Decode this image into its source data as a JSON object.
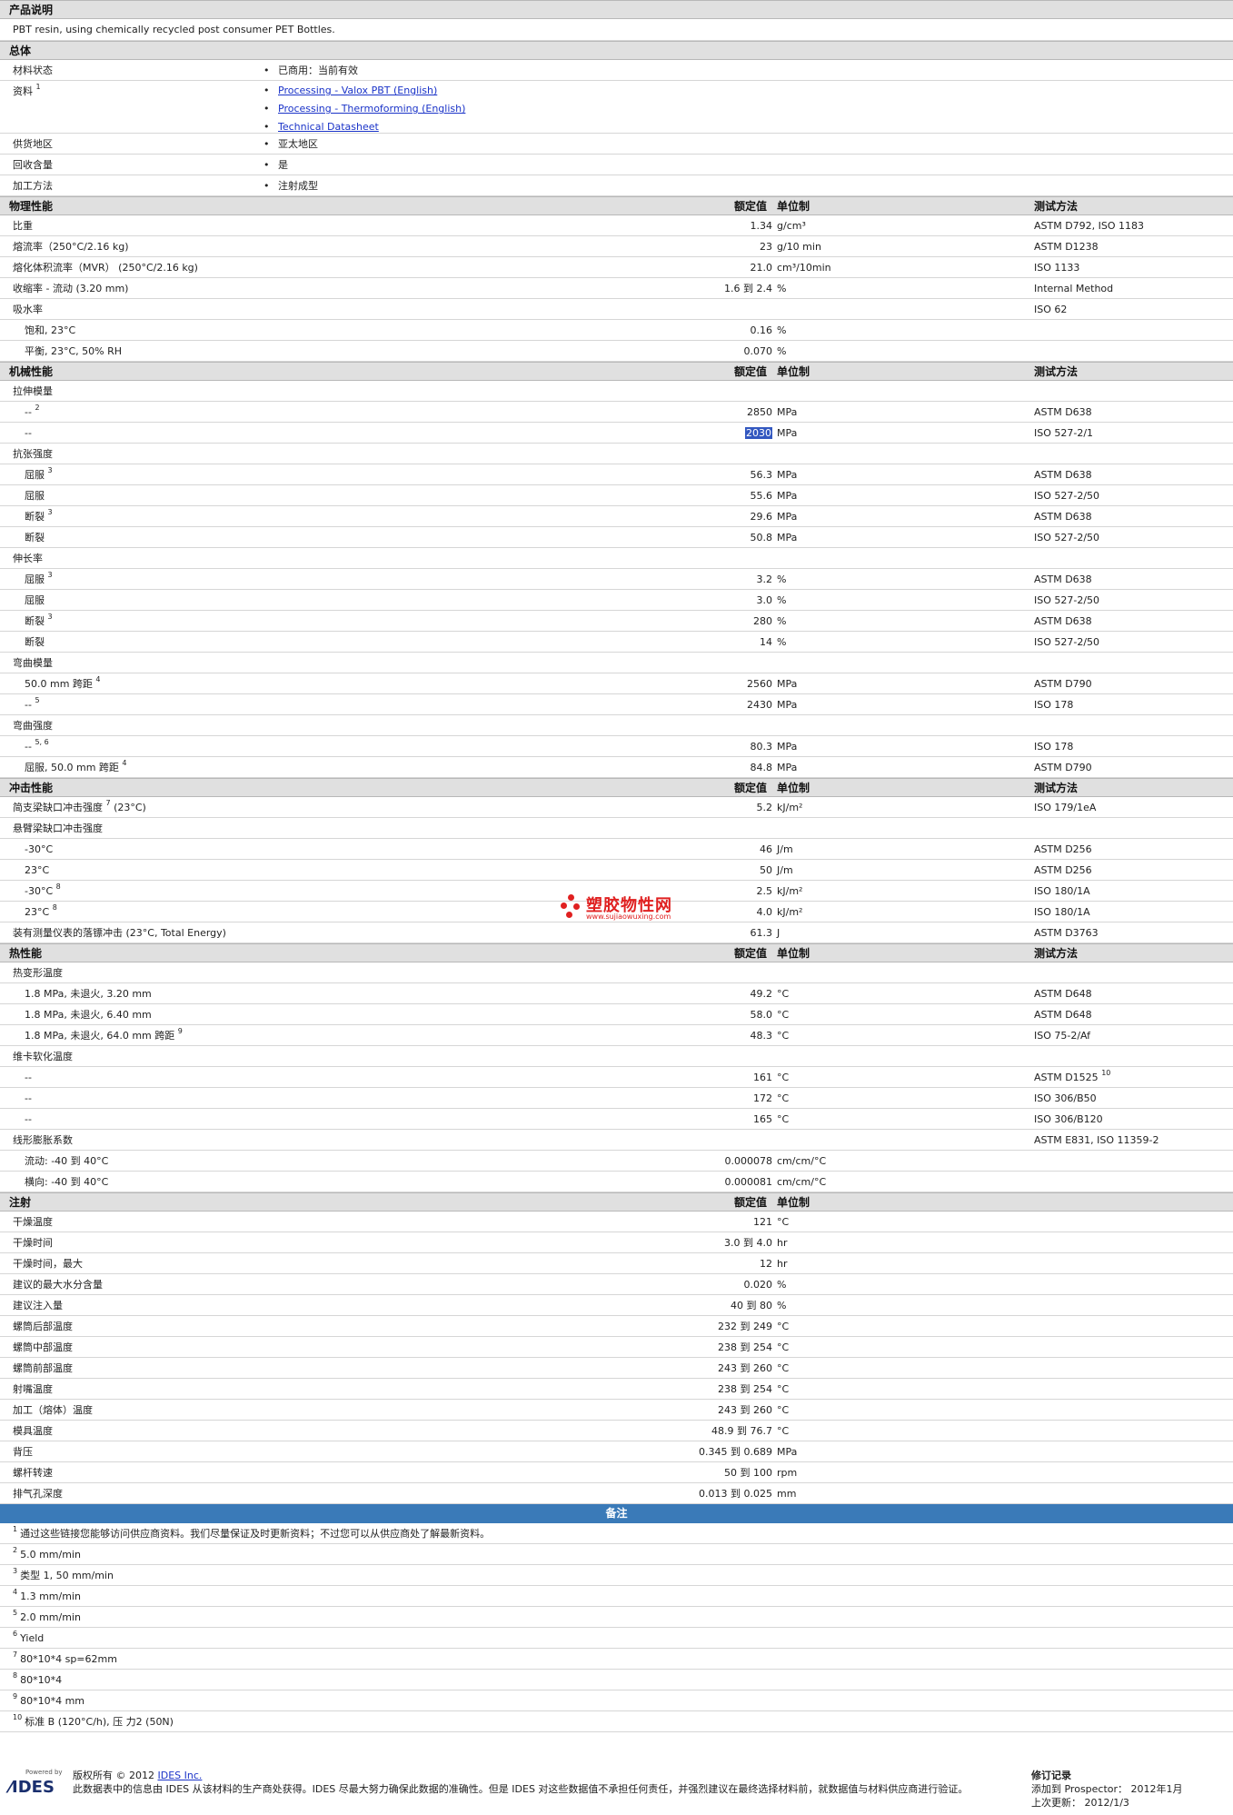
{
  "product_description": {
    "title": "产品说明",
    "text": "PBT resin, using chemically recycled post consumer PET Bottles."
  },
  "general": {
    "title": "总体",
    "rows": [
      {
        "label": "材料状态",
        "value": "已商用：当前有效"
      },
      {
        "label": "资料",
        "sup": "1",
        "links": [
          "Processing - Valox PBT (English)",
          "Processing - Thermoforming (English)",
          "Technical Datasheet"
        ]
      },
      {
        "label": "供货地区",
        "value": "亚太地区"
      },
      {
        "label": "回收含量",
        "value": "是"
      },
      {
        "label": "加工方法",
        "value": "注射成型"
      }
    ]
  },
  "column_headers": {
    "value": "额定值",
    "unit": "单位制",
    "method": "测试方法"
  },
  "sections": [
    {
      "title": "物理性能",
      "show_method_header": true,
      "rows": [
        {
          "label": "比重",
          "value": "1.34",
          "unit": "g/cm³",
          "method": "ASTM D792, ISO 1183"
        },
        {
          "label": "熔流率（250°C/2.16 kg)",
          "value": "23",
          "unit": "g/10 min",
          "method": "ASTM D1238"
        },
        {
          "label": "熔化体积流率（MVR） (250°C/2.16 kg)",
          "value": "21.0",
          "unit": "cm³/10min",
          "method": "ISO 1133"
        },
        {
          "label": "收缩率 - 流动 (3.20 mm)",
          "value": "1.6 到 2.4",
          "unit": "%",
          "method": "Internal Method"
        },
        {
          "label": "吸水率",
          "value": "",
          "unit": "",
          "method": "ISO 62"
        },
        {
          "label": "饱和, 23°C",
          "indent": true,
          "value": "0.16",
          "unit": "%",
          "method": ""
        },
        {
          "label": "平衡, 23°C, 50% RH",
          "indent": true,
          "value": "0.070",
          "unit": "%",
          "method": ""
        }
      ]
    },
    {
      "title": "机械性能",
      "show_method_header": true,
      "rows": [
        {
          "label": "拉伸模量",
          "value": "",
          "unit": "",
          "method": ""
        },
        {
          "label": "--",
          "sup": "2",
          "indent": true,
          "value": "2850",
          "unit": "MPa",
          "method": "ASTM D638"
        },
        {
          "label": "--",
          "indent": true,
          "value": "2030",
          "highlight": true,
          "unit": "MPa",
          "method": "ISO 527-2/1"
        },
        {
          "label": "抗张强度",
          "value": "",
          "unit": "",
          "method": ""
        },
        {
          "label": "屈服",
          "sup": "3",
          "indent": true,
          "value": "56.3",
          "unit": "MPa",
          "method": "ASTM D638"
        },
        {
          "label": "屈服",
          "indent": true,
          "value": "55.6",
          "unit": "MPa",
          "method": "ISO 527-2/50"
        },
        {
          "label": "断裂",
          "sup": "3",
          "indent": true,
          "value": "29.6",
          "unit": "MPa",
          "method": "ASTM D638"
        },
        {
          "label": "断裂",
          "indent": true,
          "value": "50.8",
          "unit": "MPa",
          "method": "ISO 527-2/50"
        },
        {
          "label": "伸长率",
          "value": "",
          "unit": "",
          "method": ""
        },
        {
          "label": "屈服",
          "sup": "3",
          "indent": true,
          "value": "3.2",
          "unit": "%",
          "method": "ASTM D638"
        },
        {
          "label": "屈服",
          "indent": true,
          "value": "3.0",
          "unit": "%",
          "method": "ISO 527-2/50"
        },
        {
          "label": "断裂",
          "sup": "3",
          "indent": true,
          "value": "280",
          "unit": "%",
          "method": "ASTM D638"
        },
        {
          "label": "断裂",
          "indent": true,
          "value": "14",
          "unit": "%",
          "method": "ISO 527-2/50"
        },
        {
          "label": "弯曲模量",
          "value": "",
          "unit": "",
          "method": ""
        },
        {
          "label": "50.0 mm 跨距",
          "sup": "4",
          "indent": true,
          "value": "2560",
          "unit": "MPa",
          "method": "ASTM D790"
        },
        {
          "label": "--",
          "sup": "5",
          "indent": true,
          "value": "2430",
          "unit": "MPa",
          "method": "ISO 178"
        },
        {
          "label": "弯曲强度",
          "value": "",
          "unit": "",
          "method": ""
        },
        {
          "label": "--",
          "sup": "5, 6",
          "indent": true,
          "value": "80.3",
          "unit": "MPa",
          "method": "ISO 178"
        },
        {
          "label": "屈服, 50.0 mm 跨距",
          "sup": "4",
          "indent": true,
          "value": "84.8",
          "unit": "MPa",
          "method": "ASTM D790"
        }
      ]
    },
    {
      "title": "冲击性能",
      "show_method_header": true,
      "rows": [
        {
          "label": "简支梁缺口冲击强度",
          "sup": "7",
          "suffix": " (23°C)",
          "value": "5.2",
          "unit": "kJ/m²",
          "method": "ISO 179/1eA"
        },
        {
          "label": "悬臂梁缺口冲击强度",
          "value": "",
          "unit": "",
          "method": ""
        },
        {
          "label": "-30°C",
          "indent": true,
          "value": "46",
          "unit": "J/m",
          "method": "ASTM D256"
        },
        {
          "label": "23°C",
          "indent": true,
          "value": "50",
          "unit": "J/m",
          "method": "ASTM D256"
        },
        {
          "label": "-30°C",
          "sup": "8",
          "indent": true,
          "value": "2.5",
          "unit": "kJ/m²",
          "method": "ISO 180/1A"
        },
        {
          "label": "23°C",
          "sup": "8",
          "indent": true,
          "value": "4.0",
          "unit": "kJ/m²",
          "method": "ISO 180/1A"
        },
        {
          "label": "装有测量仪表的落镖冲击 (23°C, Total Energy)",
          "value": "61.3",
          "unit": "J",
          "method": "ASTM D3763"
        }
      ]
    },
    {
      "title": "热性能",
      "show_method_header": true,
      "rows": [
        {
          "label": "热变形温度",
          "value": "",
          "unit": "",
          "method": ""
        },
        {
          "label": "1.8 MPa, 未退火, 3.20 mm",
          "indent": true,
          "value": "49.2",
          "unit": "°C",
          "method": "ASTM D648"
        },
        {
          "label": "1.8 MPa, 未退火, 6.40 mm",
          "indent": true,
          "value": "58.0",
          "unit": "°C",
          "method": "ASTM D648"
        },
        {
          "label": "1.8 MPa, 未退火, 64.0 mm 跨距",
          "sup": "9",
          "indent": true,
          "value": "48.3",
          "unit": "°C",
          "method": "ISO 75-2/Af"
        },
        {
          "label": "维卡软化温度",
          "value": "",
          "unit": "",
          "method": ""
        },
        {
          "label": "--",
          "indent": true,
          "value": "161",
          "unit": "°C",
          "method": "ASTM D1525",
          "method_sup": "10"
        },
        {
          "label": "--",
          "indent": true,
          "value": "172",
          "unit": "°C",
          "method": "ISO 306/B50"
        },
        {
          "label": "--",
          "indent": true,
          "value": "165",
          "unit": "°C",
          "method": "ISO 306/B120"
        },
        {
          "label": "线形膨胀系数",
          "value": "",
          "unit": "",
          "method": "ASTM E831, ISO 11359-2"
        },
        {
          "label": "流动: -40 到 40°C",
          "indent": true,
          "value": "0.000078",
          "unit": "cm/cm/°C",
          "method": ""
        },
        {
          "label": "横向: -40 到 40°C",
          "indent": true,
          "value": "0.000081",
          "unit": "cm/cm/°C",
          "method": ""
        }
      ]
    },
    {
      "title": "注射",
      "show_method_header": false,
      "rows": [
        {
          "label": "干燥温度",
          "value": "121",
          "unit": "°C",
          "method": ""
        },
        {
          "label": "干燥时间",
          "value": "3.0 到 4.0",
          "unit": "hr",
          "method": ""
        },
        {
          "label": "干燥时间，最大",
          "value": "12",
          "unit": "hr",
          "method": ""
        },
        {
          "label": "建议的最大水分含量",
          "value": "0.020",
          "unit": "%",
          "method": ""
        },
        {
          "label": "建议注入量",
          "value": "40 到 80",
          "unit": "%",
          "method": ""
        },
        {
          "label": "螺筒后部温度",
          "value": "232 到 249",
          "unit": "°C",
          "method": ""
        },
        {
          "label": "螺筒中部温度",
          "value": "238 到 254",
          "unit": "°C",
          "method": ""
        },
        {
          "label": "螺筒前部温度",
          "value": "243 到 260",
          "unit": "°C",
          "method": ""
        },
        {
          "label": "射嘴温度",
          "value": "238 到 254",
          "unit": "°C",
          "method": ""
        },
        {
          "label": "加工（熔体）温度",
          "value": "243 到 260",
          "unit": "°C",
          "method": ""
        },
        {
          "label": "模具温度",
          "value": "48.9 到 76.7",
          "unit": "°C",
          "method": ""
        },
        {
          "label": "背压",
          "value": "0.345 到 0.689",
          "unit": "MPa",
          "method": ""
        },
        {
          "label": "螺杆转速",
          "value": "50 到 100",
          "unit": "rpm",
          "method": ""
        },
        {
          "label": "排气孔深度",
          "value": "0.013 到 0.025",
          "unit": "mm",
          "method": ""
        }
      ]
    }
  ],
  "notes": {
    "title": "备注",
    "items": [
      {
        "num": "1",
        "text": "通过这些链接您能够访问供应商资料。我们尽量保证及时更新资料；不过您可以从供应商处了解最新资料。"
      },
      {
        "num": "2",
        "text": "5.0 mm/min"
      },
      {
        "num": "3",
        "text": "类型 1, 50 mm/min"
      },
      {
        "num": "4",
        "text": "1.3 mm/min"
      },
      {
        "num": "5",
        "text": "2.0 mm/min"
      },
      {
        "num": "6",
        "text": "Yield"
      },
      {
        "num": "7",
        "text": "80*10*4 sp=62mm"
      },
      {
        "num": "8",
        "text": "80*10*4"
      },
      {
        "num": "9",
        "text": "80*10*4 mm"
      },
      {
        "num": "10",
        "text": "标准 B (120°C/h), 压 力2 (50N)"
      }
    ]
  },
  "watermark": {
    "text": "塑胶物性网",
    "url": "www.sujiaowuxing.com",
    "color": "#e02020"
  },
  "footer": {
    "logo_caption": "Powered by",
    "logo_text": "IDES",
    "copyright_prefix": "版权所有 © 2012 ",
    "copyright_link": "IDES Inc.",
    "disclaimer": "此数据表中的信息由 IDES 从该材料的生产商处获得。IDES 尽最大努力确保此数据的准确性。但是 IDES 对这些数据值不承担任何责任，并强烈建议在最终选择材料前，就数据值与材料供应商进行验证。",
    "revision_title": "修订记录",
    "added_label": "添加到 Prospector：",
    "added_value": "2012年1月",
    "updated_label": "上次更新：",
    "updated_value": "2012/1/3"
  },
  "colors": {
    "section_bg": "#e0e0e0",
    "notes_bar": "#3a7ab8",
    "link": "#1a33c8",
    "highlight": "#3358c0"
  }
}
